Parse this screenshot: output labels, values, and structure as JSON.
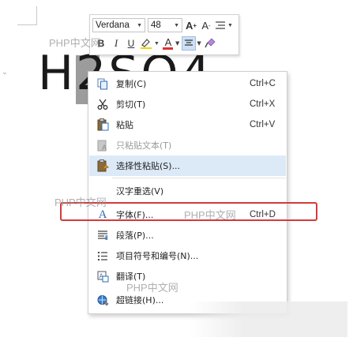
{
  "document": {
    "visible_text": "H2SO4"
  },
  "mini_toolbar": {
    "font_name": "Verdana",
    "font_size": "48",
    "grow_font": "A",
    "grow_sup": "+",
    "shrink_font": "A",
    "shrink_sup": "-",
    "bold": "B",
    "italic": "I",
    "underline": "U",
    "font_color": "A",
    "icons": [
      "line-spacing-icon",
      "text-highlight-icon",
      "center-align-icon",
      "format-painter-icon"
    ]
  },
  "context_menu": {
    "items": [
      {
        "label": "复制(C)",
        "shortcut": "Ctrl+C",
        "icon": "copy-icon"
      },
      {
        "label": "剪切(T)",
        "shortcut": "Ctrl+X",
        "icon": "scissors-icon"
      },
      {
        "label": "粘贴",
        "shortcut": "Ctrl+V",
        "icon": "paste-icon"
      },
      {
        "label": "只粘贴文本(T)",
        "shortcut": "",
        "icon": "paste-text-icon",
        "disabled": true
      },
      {
        "label": "选择性粘贴(S)...",
        "shortcut": "",
        "icon": "paste-special-icon",
        "hovered": true
      },
      {
        "label": "汉字重选(V)",
        "shortcut": "",
        "icon": ""
      },
      {
        "label": "字体(F)...",
        "shortcut": "Ctrl+D",
        "icon": "font-icon",
        "highlighted": true
      },
      {
        "label": "段落(P)...",
        "shortcut": "",
        "icon": "paragraph-icon"
      },
      {
        "label": "项目符号和编号(N)...",
        "shortcut": "",
        "icon": "bullet-list-icon"
      },
      {
        "label": "翻译(T)",
        "shortcut": "",
        "icon": "translate-icon"
      },
      {
        "label": "超链接(H)...",
        "shortcut": "",
        "icon": "hyperlink-icon"
      }
    ]
  },
  "watermark_text": "PHP中文网",
  "colors": {
    "highlight_border": "#d43a3a",
    "hover_bg": "#dce9f7",
    "accent_blue": "#2b6cb8"
  }
}
